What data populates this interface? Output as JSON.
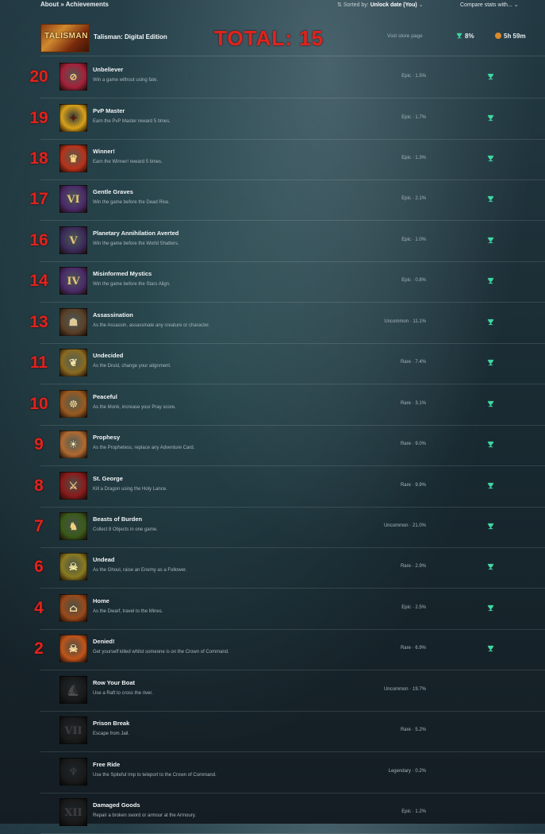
{
  "header": {
    "breadcrumb": "About » Achievements",
    "sort_label": "Sorted by:",
    "sort_value": "Unlock date (You)",
    "compare_label": "Compare stats with..."
  },
  "game": {
    "cover_text": "TALISMAN",
    "name": "Talisman: Digital Edition",
    "annotation": "TOTAL: 15",
    "visit_store": "Visit store page",
    "percent": "8%",
    "playtime": "5h 59m"
  },
  "colors": {
    "annotation_red": "#e1231d",
    "trophy_green": "#3fd6a0",
    "clock_orange": "#d98a2a"
  },
  "achievements": [
    {
      "rank": "20",
      "title": "Unbeliever",
      "desc": "Win a game without using fate.",
      "rarity": "Epic",
      "pct": "1.5%",
      "unlocked": true,
      "glyph": "⊘",
      "bg": "#a6203a",
      "fg": "#f2c07a"
    },
    {
      "rank": "19",
      "title": "PvP Master",
      "desc": "Earn the PvP Master reward 5 times.",
      "rarity": "Epic",
      "pct": "1.7%",
      "unlocked": true,
      "glyph": "✦",
      "bg": "#d8a11a",
      "fg": "#5a1a0a"
    },
    {
      "rank": "18",
      "title": "Winner!",
      "desc": "Earn the Winner! reward 5 times.",
      "rarity": "Epic",
      "pct": "1.3%",
      "unlocked": true,
      "glyph": "♛",
      "bg": "#b8321a",
      "fg": "#ffd27a"
    },
    {
      "rank": "17",
      "title": "Gentle Graves",
      "desc": "Win the game before the Dead Rise.",
      "rarity": "Epic",
      "pct": "2.1%",
      "unlocked": true,
      "glyph": "VI",
      "bg": "#4a2a6a",
      "fg": "#e8c47a"
    },
    {
      "rank": "16",
      "title": "Planetary Annihilation Averted",
      "desc": "Win the game before the World Shatters.",
      "rarity": "Epic",
      "pct": "1.0%",
      "unlocked": true,
      "glyph": "V",
      "bg": "#3a2a5a",
      "fg": "#e8c47a"
    },
    {
      "rank": "14",
      "title": "Misinformed Mystics",
      "desc": "Win the game before the Stars Align.",
      "rarity": "Epic",
      "pct": "0.8%",
      "unlocked": true,
      "glyph": "IV",
      "bg": "#4a2a6a",
      "fg": "#e8c47a"
    },
    {
      "rank": "13",
      "title": "Assassination",
      "desc": "As the Assassin, assassinate any creature or character.",
      "rarity": "Uncommon",
      "pct": "11.1%",
      "unlocked": true,
      "glyph": "☗",
      "bg": "#5a4028",
      "fg": "#e0c89a"
    },
    {
      "rank": "11",
      "title": "Undecided",
      "desc": "As the Druid, change your alignment.",
      "rarity": "Rare",
      "pct": "7.4%",
      "unlocked": true,
      "glyph": "❦",
      "bg": "#8a6a20",
      "fg": "#f4e0a0"
    },
    {
      "rank": "10",
      "title": "Peaceful",
      "desc": "As the Monk, increase your Pray score.",
      "rarity": "Rare",
      "pct": "3.1%",
      "unlocked": true,
      "glyph": "☸",
      "bg": "#9a5a20",
      "fg": "#f8d890"
    },
    {
      "rank": "9",
      "title": "Prophesy",
      "desc": "As the Prophetess, replace any Adventure Card.",
      "rarity": "Rare",
      "pct": "9.0%",
      "unlocked": true,
      "glyph": "☀",
      "bg": "#b06a30",
      "fg": "#fde6b0"
    },
    {
      "rank": "8",
      "title": "St. George",
      "desc": "Kill a Dragon using the Holy Lance.",
      "rarity": "Rare",
      "pct": "9.9%",
      "unlocked": true,
      "glyph": "⚔",
      "bg": "#8a1a1a",
      "fg": "#f0c080"
    },
    {
      "rank": "7",
      "title": "Beasts of Burden",
      "desc": "Collect 8 Objects in one game.",
      "rarity": "Uncommon",
      "pct": "21.0%",
      "unlocked": true,
      "glyph": "♞",
      "bg": "#3a5a1a",
      "fg": "#f0d080"
    },
    {
      "rank": "6",
      "title": "Undead",
      "desc": "As the Ghoul, raise an Enemy as a Follower.",
      "rarity": "Rare",
      "pct": "2.9%",
      "unlocked": true,
      "glyph": "☠",
      "bg": "#8a7a20",
      "fg": "#f4e8a0"
    },
    {
      "rank": "4",
      "title": "Home",
      "desc": "As the Dwarf, travel to the Mines.",
      "rarity": "Epic",
      "pct": "2.5%",
      "unlocked": true,
      "glyph": "⌂",
      "bg": "#9a4a1a",
      "fg": "#f8e0a0"
    },
    {
      "rank": "2",
      "title": "Denied!",
      "desc": "Get yourself killed whilst someone is on the Crown of Command.",
      "rarity": "Rare",
      "pct": "6.9%",
      "unlocked": true,
      "glyph": "☠",
      "bg": "#c0541a",
      "fg": "#ffe0a0"
    },
    {
      "rank": "",
      "title": "Row Your Boat",
      "desc": "Use a Raft to cross the river.",
      "rarity": "Uncommon",
      "pct": "19.7%",
      "unlocked": false,
      "glyph": "⛵",
      "bg": "#3a3a3a",
      "fg": "#8a8a8a"
    },
    {
      "rank": "",
      "title": "Prison Break",
      "desc": "Escape from Jail.",
      "rarity": "Rare",
      "pct": "5.2%",
      "unlocked": false,
      "glyph": "VII",
      "bg": "#3a3a3a",
      "fg": "#8a8a8a"
    },
    {
      "rank": "",
      "title": "Free Ride",
      "desc": "Use the Spiteful Imp to teleport to the Crown of Command.",
      "rarity": "Legendary",
      "pct": "0.2%",
      "unlocked": false,
      "glyph": "♆",
      "bg": "#3a3a3a",
      "fg": "#8a8a8a"
    },
    {
      "rank": "",
      "title": "Damaged Goods",
      "desc": "Repair a broken sword or armour at the Armoury.",
      "rarity": "Epic",
      "pct": "1.2%",
      "unlocked": false,
      "glyph": "XII",
      "bg": "#3a3a3a",
      "fg": "#8a8a8a"
    }
  ]
}
